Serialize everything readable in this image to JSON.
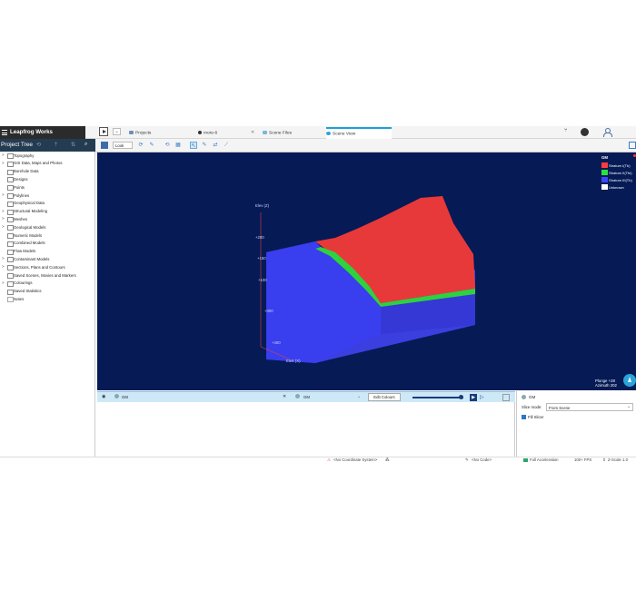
{
  "app": {
    "title": "Leapfrog Works"
  },
  "tabs": [
    {
      "label": "Projects"
    },
    {
      "label": "more-6"
    },
    {
      "label": "Scene Files"
    },
    {
      "label": "Scene View"
    }
  ],
  "left_panel": {
    "title": "Project Tree",
    "items": [
      {
        "label": "Topography"
      },
      {
        "label": "GIS Data, Maps and Photos"
      },
      {
        "label": "Borehole Data"
      },
      {
        "label": "Designs"
      },
      {
        "label": "Points"
      },
      {
        "label": "Polylines"
      },
      {
        "label": "Geophysical Data"
      },
      {
        "label": "Structural Modeling"
      },
      {
        "label": "Meshes"
      },
      {
        "label": "Geological Models"
      },
      {
        "label": "Numeric Models"
      },
      {
        "label": "Combined Models"
      },
      {
        "label": "Flow Models"
      },
      {
        "label": "Contaminant Models"
      },
      {
        "label": "Sections, Plans and Contours"
      },
      {
        "label": "Saved Scenes, Movies and Markers"
      },
      {
        "label": "Colourings"
      },
      {
        "label": "Saved Statistics"
      },
      {
        "label": "Notes"
      }
    ]
  },
  "toolbar": {
    "look_label": "Look"
  },
  "scene": {
    "legend": {
      "title": "GM",
      "items": [
        {
          "label": "Stratum I(Tb)",
          "color": "#ff3b3b"
        },
        {
          "label": "Stratum II(Tbi)",
          "color": "#29e23e"
        },
        {
          "label": "Stratum III(Tb)",
          "color": "#3b46ff"
        },
        {
          "label": "Unknown",
          "color": "#ffffff"
        }
      ]
    },
    "axis": {
      "elev": "Elev (Z)",
      "east": "East (X)",
      "z_ticks": [
        "+200",
        "+150",
        "+100",
        "+300",
        "+400"
      ]
    },
    "plunge": "Plunge +28",
    "azimuth": "Azimuth 202"
  },
  "shape_list": {
    "item1": "GM",
    "item2": "GM",
    "edit_colours": "Edit Colours"
  },
  "properties": {
    "title": "GM",
    "slice_mode_label": "Slice mode:",
    "slice_mode_value": "From Scene",
    "fill_slicer": "Fill Slicer"
  },
  "status": {
    "coord": "<No Coordinate System>",
    "code": "<No Code>",
    "accel": "Full Acceleration",
    "fps": "100+ FPS",
    "zscale": "Z-Scale 1.0"
  }
}
